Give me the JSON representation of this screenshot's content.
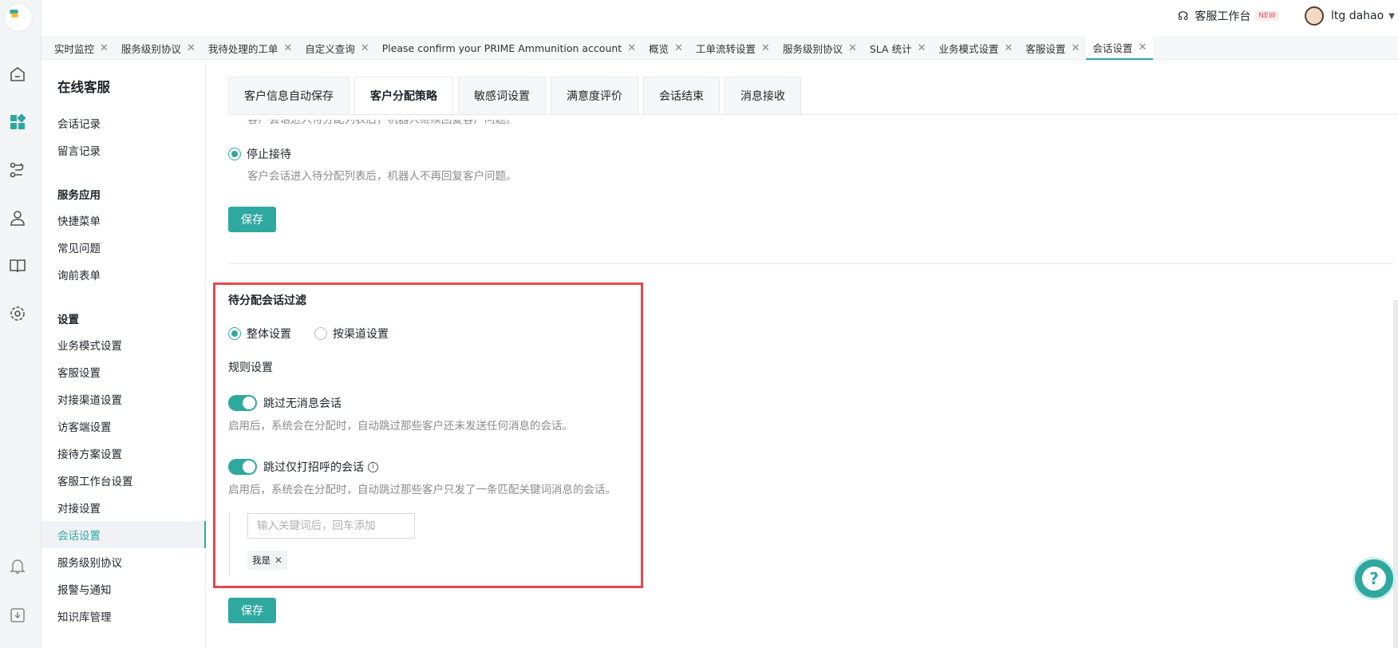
{
  "header": {
    "workspace_label": "客服工作台",
    "new_badge": "NEW",
    "username": "ltg dahao"
  },
  "tabs": [
    {
      "label": "实时监控"
    },
    {
      "label": "服务级别协议"
    },
    {
      "label": "我待处理的工单"
    },
    {
      "label": "自定义查询"
    },
    {
      "label": "Please confirm your PRIME Ammunition account"
    },
    {
      "label": "概览"
    },
    {
      "label": "工单流转设置"
    },
    {
      "label": "服务级别协议"
    },
    {
      "label": "SLA 统计"
    },
    {
      "label": "业务模式设置"
    },
    {
      "label": "客服设置"
    },
    {
      "label": "会话设置",
      "active": true
    }
  ],
  "sidebar": {
    "title": "在线客服",
    "items": [
      {
        "label": "会话记录"
      },
      {
        "label": "留言记录"
      }
    ],
    "group_apps": "服务应用",
    "apps": [
      {
        "label": "快捷菜单"
      },
      {
        "label": "常见问题"
      },
      {
        "label": "询前表单"
      }
    ],
    "group_settings": "设置",
    "settings": [
      {
        "label": "业务模式设置"
      },
      {
        "label": "客服设置"
      },
      {
        "label": "对接渠道设置"
      },
      {
        "label": "访客端设置"
      },
      {
        "label": "接待方案设置"
      },
      {
        "label": "客服工作台设置"
      },
      {
        "label": "对接设置"
      },
      {
        "label": "会话设置",
        "active": true
      },
      {
        "label": "服务级别协议"
      },
      {
        "label": "报警与通知"
      },
      {
        "label": "知识库管理"
      }
    ]
  },
  "subtabs": [
    {
      "label": "客户信息自动保存"
    },
    {
      "label": "客户分配策略",
      "active": true
    },
    {
      "label": "敏感词设置"
    },
    {
      "label": "满意度评价"
    },
    {
      "label": "会话结束"
    },
    {
      "label": "消息接收"
    }
  ],
  "top_section": {
    "truncated_hint": "客户会话进入待分配列表后，机器人继续回复客户问题。",
    "stop_label": "停止接待",
    "stop_hint": "客户会话进入待分配列表后，机器人不再回复客户问题。",
    "save_label": "保存"
  },
  "filter_section": {
    "title": "待分配会话过滤",
    "scope_whole": "整体设置",
    "scope_channel": "按渠道设置",
    "rules_label": "规则设置",
    "skip_empty_label": "跳过无消息会话",
    "skip_empty_enabled": true,
    "skip_empty_hint": "启用后，系统会在分配时，自动跳过那些客户还未发送任何消息的会话。",
    "skip_greeting_label": "跳过仅打招呼的会话",
    "skip_greeting_enabled": true,
    "skip_greeting_hint": "启用后，系统会在分配时，自动跳过那些客户只发了一条匹配关键词消息的会话。",
    "keyword_placeholder": "输入关键词后，回车添加",
    "keywords": [
      "我是"
    ],
    "save_label": "保存"
  },
  "colors": {
    "accent": "#2fa8a0",
    "highlight_border": "#e5484d"
  }
}
